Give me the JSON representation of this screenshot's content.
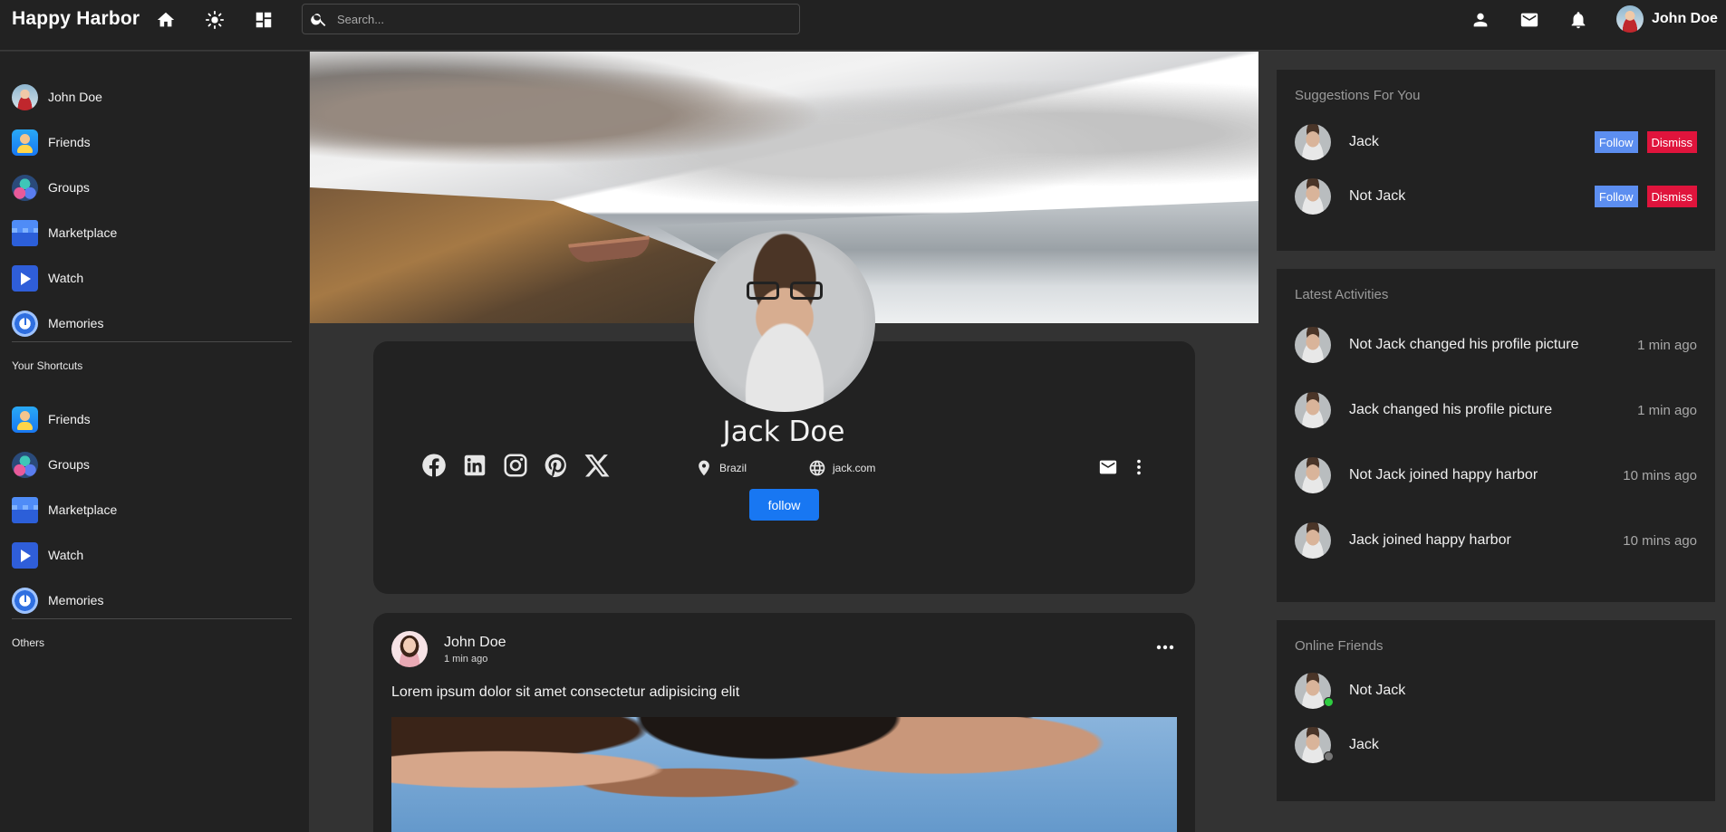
{
  "colors": {
    "accent": "#1877f2",
    "follow": "#5c8ef0",
    "dismiss": "#e0143c",
    "online": "#2ecc40",
    "offline": "#777777"
  },
  "navbar": {
    "logo": "Happy Harbor",
    "icons": [
      "home-icon",
      "theme-icon",
      "apps-icon",
      "person-icon",
      "mail-icon",
      "bell-icon"
    ],
    "search_placeholder": "Search...",
    "user_name": "John Doe"
  },
  "leftbar": {
    "items": [
      {
        "label": "John Doe",
        "icon": "avatar"
      },
      {
        "label": "Friends",
        "icon": "friends-icon"
      },
      {
        "label": "Groups",
        "icon": "groups-icon"
      },
      {
        "label": "Marketplace",
        "icon": "marketplace-icon"
      },
      {
        "label": "Watch",
        "icon": "watch-icon"
      },
      {
        "label": "Memories",
        "icon": "memories-icon"
      }
    ],
    "shortcuts_title": "Your Shortcuts",
    "shortcuts": [
      {
        "label": "Friends",
        "icon": "friends-icon"
      },
      {
        "label": "Groups",
        "icon": "groups-icon"
      },
      {
        "label": "Marketplace",
        "icon": "marketplace-icon"
      },
      {
        "label": "Watch",
        "icon": "watch-icon"
      },
      {
        "label": "Memories",
        "icon": "memories-icon"
      }
    ],
    "others_title": "Others"
  },
  "profile": {
    "name": "Jack Doe",
    "location": "Brazil",
    "website": "jack.com",
    "follow_label": "follow",
    "socials": [
      "facebook-icon",
      "linkedin-icon",
      "instagram-icon",
      "pinterest-icon",
      "x-icon"
    ]
  },
  "post": {
    "author": "John Doe",
    "time": "1 min ago",
    "text": "Lorem ipsum dolor sit amet consectetur adipisicing elit"
  },
  "suggestions": {
    "title": "Suggestions For You",
    "follow_label": "Follow",
    "dismiss_label": "Dismiss",
    "users": [
      {
        "name": "Jack"
      },
      {
        "name": "Not Jack"
      }
    ]
  },
  "activities": {
    "title": "Latest Activities",
    "items": [
      {
        "user": "Not Jack",
        "action": "changed his profile picture",
        "time": "1 min ago"
      },
      {
        "user": "Jack",
        "action": "changed his profile picture",
        "time": "1 min ago"
      },
      {
        "user": "Not Jack",
        "action": "joined happy harbor",
        "time": "10 mins ago"
      },
      {
        "user": "Jack",
        "action": "joined happy harbor",
        "time": "10 mins ago"
      }
    ]
  },
  "online_friends": {
    "title": "Online Friends",
    "users": [
      {
        "name": "Not Jack",
        "status": "online"
      },
      {
        "name": "Jack",
        "status": "offline"
      }
    ]
  }
}
